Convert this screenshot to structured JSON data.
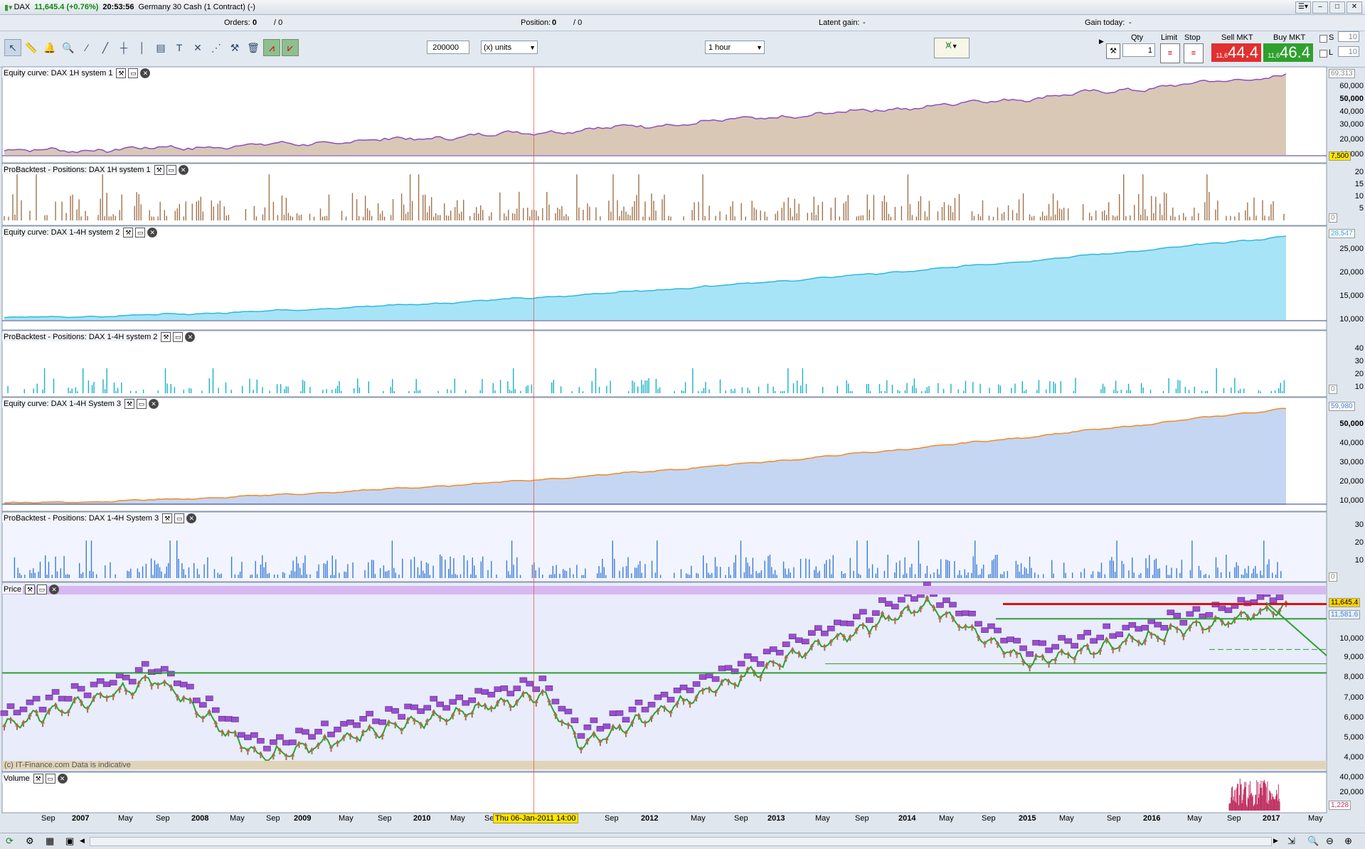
{
  "titlebar": {
    "instrument": "DAX",
    "quote": "11,645.4 (+0.76%)",
    "time": "20:53:56",
    "description": "Germany 30 Cash (1 Contract) (-)"
  },
  "infobar": {
    "orders_label": "Orders:",
    "orders_value": "0",
    "orders_total": "/ 0",
    "position_label": "Position:",
    "position_value": "0",
    "position_total": "/ 0",
    "latent_label": "Latent gain:",
    "latent_value": "-",
    "gain_today_label": "Gain today:",
    "gain_today_value": "-"
  },
  "toolbar": {
    "units_value": "200000",
    "units_select": "(x) units",
    "timeframe": "1 hour"
  },
  "order_panel": {
    "qty_label": "Qty",
    "qty_value": "1",
    "limit_label": "Limit",
    "stop_label": "Stop",
    "sell_label": "Sell MKT",
    "sell_prefix": "11,6",
    "sell_big": "44.4",
    "buy_label": "Buy MKT",
    "buy_prefix": "11,6",
    "buy_big": "46.4",
    "s_label": "S",
    "s_value": "10",
    "l_label": "L",
    "l_value": "10"
  },
  "panels": [
    {
      "title": "Equity curve: DAX 1H system 1",
      "axis": [
        "60,000",
        "50,000",
        "40,000",
        "30,000",
        "20,000",
        "10,000"
      ],
      "top_tag": "69,313",
      "bottom_tag": "7,500"
    },
    {
      "title": "ProBacktest - Positions: DAX 1H system 1",
      "axis": [
        "20",
        "15",
        "10",
        "5"
      ],
      "bottom_tag": "0"
    },
    {
      "title": "Equity curve: DAX 1-4H system 2",
      "axis": [
        "25,000",
        "20,000",
        "15,000",
        "10,000"
      ],
      "top_tag": "28,547"
    },
    {
      "title": "ProBacktest - Positions: DAX 1-4H system 2",
      "axis": [
        "40",
        "30",
        "20",
        "10"
      ],
      "bottom_tag": "0"
    },
    {
      "title": "Equity curve: DAX 1-4H System 3",
      "axis": [
        "50,000",
        "40,000",
        "30,000",
        "20,000",
        "10,000"
      ],
      "top_tag": "59,980"
    },
    {
      "title": "ProBacktest - Positions: DAX 1-4H System 3",
      "axis": [
        "30",
        "20",
        "10"
      ],
      "bottom_tag": "0"
    },
    {
      "title": "Price",
      "axis": [
        "10,000",
        "9,000",
        "8,000",
        "7,000",
        "6,000",
        "5,000",
        "4,000"
      ],
      "top_tag": "11,645.4",
      "second_tag": "11,581.6"
    },
    {
      "title": "Volume",
      "axis": [
        "40,000",
        "20,000"
      ],
      "bottom_tag": "1,228"
    }
  ],
  "price_watermark": "(c) IT-Finance.com  Data is indicative",
  "xaxis": [
    {
      "label": "Sep",
      "bold": false
    },
    {
      "label": "2007",
      "bold": true
    },
    {
      "label": "May",
      "bold": false
    },
    {
      "label": "Sep",
      "bold": false
    },
    {
      "label": "2008",
      "bold": true
    },
    {
      "label": "May",
      "bold": false
    },
    {
      "label": "Sep",
      "bold": false
    },
    {
      "label": "2009",
      "bold": true
    },
    {
      "label": "May",
      "bold": false
    },
    {
      "label": "Sep",
      "bold": false
    },
    {
      "label": "2010",
      "bold": true
    },
    {
      "label": "May",
      "bold": false
    },
    {
      "label": "Se",
      "bold": false
    },
    {
      "label": "Sep",
      "bold": false
    },
    {
      "label": "2012",
      "bold": true
    },
    {
      "label": "May",
      "bold": false
    },
    {
      "label": "Sep",
      "bold": false
    },
    {
      "label": "2013",
      "bold": true
    },
    {
      "label": "May",
      "bold": false
    },
    {
      "label": "Sep",
      "bold": false
    },
    {
      "label": "2014",
      "bold": true
    },
    {
      "label": "May",
      "bold": false
    },
    {
      "label": "Sep",
      "bold": false
    },
    {
      "label": "2015",
      "bold": true
    },
    {
      "label": "May",
      "bold": false
    },
    {
      "label": "Sep",
      "bold": false
    },
    {
      "label": "2016",
      "bold": true
    },
    {
      "label": "May",
      "bold": false
    },
    {
      "label": "Sep",
      "bold": false
    },
    {
      "label": "2017",
      "bold": true
    },
    {
      "label": "May",
      "bold": false
    }
  ],
  "cursor_label": "Thu 06-Jan-2011 14:00",
  "colors": {
    "equity1_fill": "#d9c8b6",
    "equity1_line": "#8b4fc4",
    "positions1": "#a0724a",
    "equity2_fill": "#a8e4f8",
    "positions2": "#19b0c8",
    "equity3_fill": "#c5d6f2",
    "equity3_line": "#f08a28",
    "positions3": "#3a7ad6",
    "sell": "#e03030",
    "buy": "#2ea02e"
  }
}
